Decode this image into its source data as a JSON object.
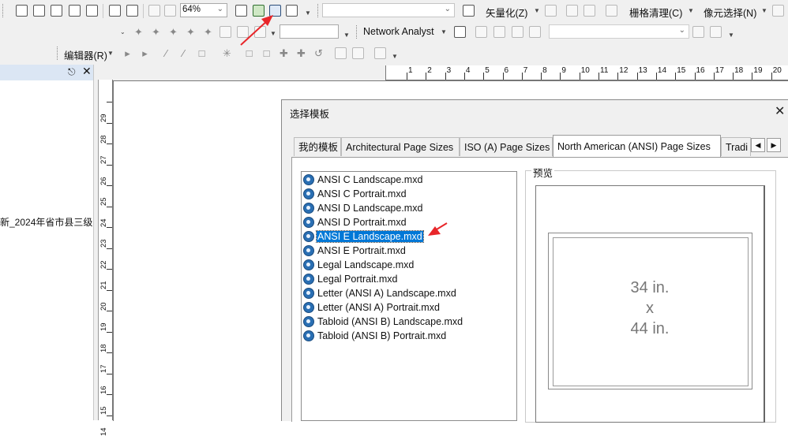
{
  "toolbar1": {
    "zoom_value": "64%",
    "vectorize_menu": "矢量化(Z)",
    "raster_cleanup_menu": "栅格清理(C)",
    "cell_select_menu": "像元选择(N)"
  },
  "toolbar2": {
    "network_analyst": "Network Analyst"
  },
  "toolbar3": {
    "editor_menu": "编辑器(R)"
  },
  "left_panel": {
    "pin_icon": "pin-icon",
    "close_icon": "close-icon",
    "layer_text": "新_2024年省市县三级"
  },
  "ruler": {
    "h_numbers": [
      "1",
      "2",
      "3",
      "4",
      "5",
      "6",
      "7",
      "8",
      "9",
      "10",
      "11",
      "12",
      "13",
      "14",
      "15",
      "16",
      "17",
      "18",
      "19",
      "20"
    ],
    "v_numbers": [
      "29",
      "28",
      "27",
      "26",
      "25",
      "24",
      "23",
      "22",
      "21",
      "20",
      "19",
      "18",
      "17",
      "16",
      "15",
      "14"
    ]
  },
  "dialog": {
    "title": "选择模板",
    "tabs": [
      {
        "label": "我的模板"
      },
      {
        "label": "Architectural Page Sizes"
      },
      {
        "label": "ISO (A) Page Sizes"
      },
      {
        "label": "North American (ANSI) Page Sizes"
      },
      {
        "label": "Tradi"
      }
    ],
    "active_tab": "North American (ANSI) Page Sizes",
    "templates": [
      {
        "label": "ANSI C Landscape.mxd",
        "selected": false
      },
      {
        "label": "ANSI C Portrait.mxd",
        "selected": false
      },
      {
        "label": "ANSI D Landscape.mxd",
        "selected": false
      },
      {
        "label": "ANSI D Portrait.mxd",
        "selected": false
      },
      {
        "label": "ANSI E Landscape.mxd",
        "selected": true
      },
      {
        "label": "ANSI E Portrait.mxd",
        "selected": false
      },
      {
        "label": "Legal Landscape.mxd",
        "selected": false
      },
      {
        "label": "Legal Portrait.mxd",
        "selected": false
      },
      {
        "label": "Letter (ANSI A) Landscape.mxd",
        "selected": false
      },
      {
        "label": "Letter (ANSI A) Portrait.mxd",
        "selected": false
      },
      {
        "label": "Tabloid (ANSI B) Landscape.mxd",
        "selected": false
      },
      {
        "label": "Tabloid (ANSI B) Portrait.mxd",
        "selected": false
      }
    ],
    "preview_label": "预览",
    "preview": {
      "width": "34 in.",
      "x": "x",
      "height": "44 in."
    }
  },
  "colors": {
    "selection": "#0078d7",
    "annotation_arrow": "#e8262a"
  }
}
